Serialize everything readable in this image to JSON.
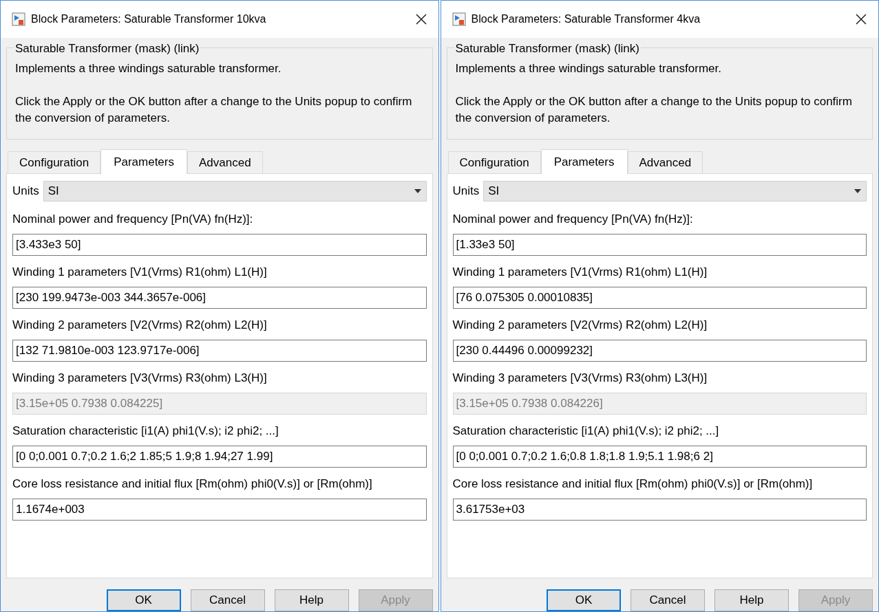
{
  "dialogs": [
    {
      "title": "Block Parameters: Saturable Transformer 10kva",
      "group_title": "Saturable Transformer (mask) (link)",
      "description": [
        "Implements a three windings saturable transformer.",
        "Click the Apply or the OK button after a change to the Units popup to confirm the conversion of parameters."
      ],
      "tabs": [
        {
          "label": "Configuration",
          "selected": false
        },
        {
          "label": "Parameters",
          "selected": true
        },
        {
          "label": "Advanced",
          "selected": false
        }
      ],
      "units": {
        "label": "Units",
        "value": "SI"
      },
      "parameters": [
        {
          "label": "Nominal power and frequency [Pn(VA) fn(Hz)]:",
          "value": "[3.433e3 50]",
          "disabled": false
        },
        {
          "label": "Winding 1 parameters [V1(Vrms) R1(ohm) L1(H)]",
          "value": "[230 199.9473e-003 344.3657e-006]",
          "disabled": false
        },
        {
          "label": "Winding 2 parameters [V2(Vrms) R2(ohm) L2(H)]",
          "value": "[132 71.9810e-003 123.9717e-006]",
          "disabled": false
        },
        {
          "label": "Winding 3 parameters [V3(Vrms) R3(ohm) L3(H)]",
          "value": "[3.15e+05 0.7938 0.084225]",
          "disabled": true
        },
        {
          "label": "Saturation characteristic [i1(A) phi1(V.s); i2 phi2; ...]",
          "value": "[0 0;0.001 0.7;0.2 1.6;2 1.85;5 1.9;8 1.94;27 1.99]",
          "disabled": false
        },
        {
          "label": "Core loss resistance and initial flux [Rm(ohm) phi0(V.s)] or [Rm(ohm)]",
          "value": "1.1674e+003",
          "disabled": false
        }
      ],
      "buttons": [
        {
          "label": "OK",
          "default": true,
          "disabled": false
        },
        {
          "label": "Cancel",
          "default": false,
          "disabled": false
        },
        {
          "label": "Help",
          "default": false,
          "disabled": false
        },
        {
          "label": "Apply",
          "default": false,
          "disabled": true
        }
      ]
    },
    {
      "title": "Block Parameters: Saturable Transformer 4kva",
      "group_title": "Saturable Transformer (mask) (link)",
      "description": [
        "Implements a three windings saturable transformer.",
        "Click the Apply or the OK button after a change to the Units popup to confirm the conversion of parameters."
      ],
      "tabs": [
        {
          "label": "Configuration",
          "selected": false
        },
        {
          "label": "Parameters",
          "selected": true
        },
        {
          "label": "Advanced",
          "selected": false
        }
      ],
      "units": {
        "label": "Units",
        "value": "SI"
      },
      "parameters": [
        {
          "label": "Nominal power and frequency [Pn(VA) fn(Hz)]:",
          "value": "[1.33e3 50]",
          "disabled": false
        },
        {
          "label": "Winding 1 parameters [V1(Vrms) R1(ohm) L1(H)]",
          "value": "[76 0.075305 0.00010835]",
          "disabled": false
        },
        {
          "label": "Winding 2 parameters [V2(Vrms) R2(ohm) L2(H)]",
          "value": "[230 0.44496 0.00099232]",
          "disabled": false
        },
        {
          "label": "Winding 3 parameters [V3(Vrms) R3(ohm) L3(H)]",
          "value": "[3.15e+05 0.7938 0.084226]",
          "disabled": true
        },
        {
          "label": "Saturation characteristic [i1(A) phi1(V.s); i2 phi2; ...]",
          "value": "[0 0;0.001 0.7;0.2 1.6;0.8 1.8;1.8 1.9;5.1 1.98;6 2]",
          "disabled": false
        },
        {
          "label": "Core loss resistance and initial flux [Rm(ohm) phi0(V.s)] or [Rm(ohm)]",
          "value": "3.61753e+03",
          "disabled": false
        }
      ],
      "buttons": [
        {
          "label": "OK",
          "default": true,
          "disabled": false
        },
        {
          "label": "Cancel",
          "default": false,
          "disabled": false
        },
        {
          "label": "Help",
          "default": false,
          "disabled": false
        },
        {
          "label": "Apply",
          "default": false,
          "disabled": true
        }
      ]
    }
  ]
}
